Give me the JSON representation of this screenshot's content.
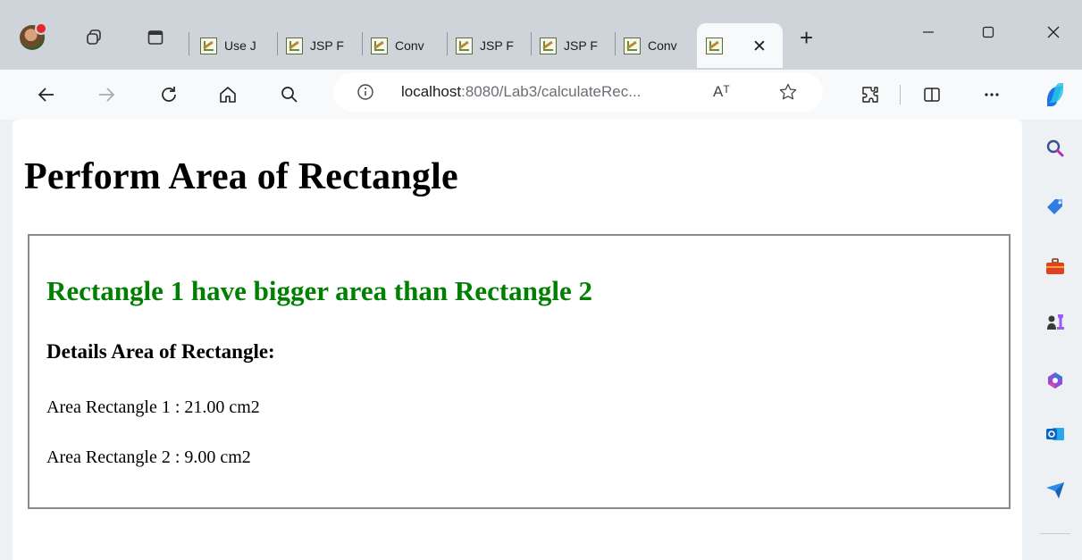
{
  "browser": {
    "tabs": [
      {
        "label": "Use J"
      },
      {
        "label": "JSP F"
      },
      {
        "label": "Conv"
      },
      {
        "label": "JSP F"
      },
      {
        "label": "JSP F"
      },
      {
        "label": "Conv"
      },
      {
        "label": "",
        "active": true
      }
    ],
    "new_tab_label": "+",
    "address": {
      "host": "localhost",
      "path": ":8080/Lab3/calculateRec..."
    },
    "read_aloud_label": "Aᵀ",
    "icons": [
      "profile-avatar",
      "workspaces-icon",
      "tab-actions-icon",
      "back-icon",
      "forward-icon",
      "refresh-icon",
      "home-icon",
      "search-icon",
      "info-icon",
      "favorite-star-icon",
      "extensions-icon",
      "split-screen-icon",
      "more-icon",
      "copilot-icon",
      "minimize-icon",
      "maximize-icon",
      "close-icon"
    ],
    "sidebar_icons": [
      "search-icon",
      "shopping-tag-icon",
      "tools-briefcase-icon",
      "games-icon",
      "microsoft365-icon",
      "outlook-icon",
      "send-icon"
    ],
    "colors": {
      "accent_green": "#008000",
      "tabstrip": "#cfd4da",
      "toolbar": "#f8f9fa"
    }
  },
  "page": {
    "title": "Perform Area of Rectangle",
    "result": "Rectangle 1 have bigger area than Rectangle 2",
    "details_heading": "Details Area of Rectangle:",
    "area1": "Area Rectangle 1 : 21.00 cm2",
    "area2": "Area Rectangle 2 : 9.00 cm2"
  }
}
